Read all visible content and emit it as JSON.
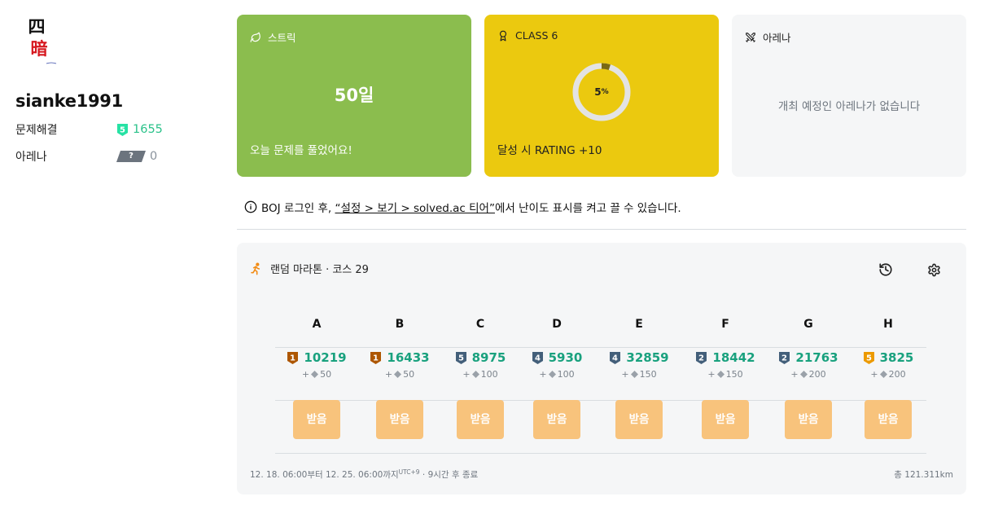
{
  "profile": {
    "username": "sianke1991",
    "avatar_chars": [
      "四",
      "暗"
    ],
    "stats": [
      {
        "label": "문제해결",
        "tier": "5",
        "value": "1655"
      },
      {
        "label": "아레나",
        "tier": "?",
        "value": "0"
      }
    ]
  },
  "cards": {
    "streak": {
      "title": "스트릭",
      "days": "50일",
      "message": "오늘 문제를 풀었어요!"
    },
    "class": {
      "title": "CLASS 6",
      "percent": "5",
      "percent_unit": "%",
      "progress": 0.05,
      "reward": "달성 시 RATING +10"
    },
    "arena": {
      "title": "아레나",
      "message": "개최 예정인 아레나가 없습니다"
    }
  },
  "notice": {
    "prefix": "BOJ 로그인 후, ",
    "link": "“설정 > 보기 > solved.ac 티어”",
    "suffix": "에서 난이도 표시를 켜고 끌 수 있습니다."
  },
  "marathon": {
    "title": "랜덤 마라톤 · 코스 29",
    "problems": [
      {
        "letter": "A",
        "tier": "1",
        "color": "#ad5600",
        "id": "10219",
        "points": "50",
        "button": "받음"
      },
      {
        "letter": "B",
        "tier": "1",
        "color": "#ad5600",
        "id": "16433",
        "points": "50",
        "button": "받음"
      },
      {
        "letter": "C",
        "tier": "5",
        "color": "#435f7a",
        "id": "8975",
        "points": "100",
        "button": "받음"
      },
      {
        "letter": "D",
        "tier": "4",
        "color": "#435f7a",
        "id": "5930",
        "points": "100",
        "button": "받음"
      },
      {
        "letter": "E",
        "tier": "4",
        "color": "#435f7a",
        "id": "32859",
        "points": "150",
        "button": "받음"
      },
      {
        "letter": "F",
        "tier": "2",
        "color": "#435f7a",
        "id": "18442",
        "points": "150",
        "button": "받음"
      },
      {
        "letter": "G",
        "tier": "2",
        "color": "#435f7a",
        "id": "21763",
        "points": "200",
        "button": "받음"
      },
      {
        "letter": "H",
        "tier": "5",
        "color": "#ec9a00",
        "id": "3825",
        "points": "200",
        "button": "받음"
      }
    ],
    "points_prefix": "+",
    "period": "12. 18. 06:00부터 12. 25. 06:00까지",
    "timezone": "UTC+9",
    "remaining": " · 9시간 후 종료",
    "distance": "총 121.311km"
  },
  "colors": {
    "streak_bg": "#8bbd4e",
    "class_bg": "#ebc90f",
    "panel_bg": "#f5f6f7",
    "problem_id": "#19a17e",
    "button_bg": "#f8c37c",
    "solved_count": "#2bc28a"
  }
}
